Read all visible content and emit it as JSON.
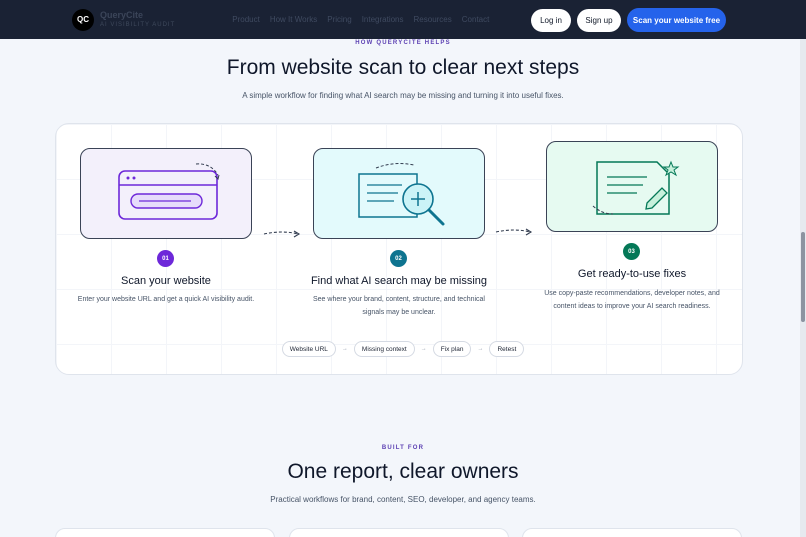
{
  "nav": {
    "logo_initials": "QC",
    "brand_name": "QueryCite",
    "brand_tagline": "AI VISIBILITY AUDIT",
    "links": [
      "Product",
      "How It Works",
      "Pricing",
      "Integrations",
      "Resources",
      "Contact"
    ],
    "login_label": "Log in",
    "signup_label": "Sign up",
    "cta_label": "Scan your website free"
  },
  "how": {
    "eyebrow": "HOW QUERYCITE HELPS",
    "title": "From website scan to clear next steps",
    "subtitle": "A simple workflow for finding what AI search may be missing and turning it into useful fixes.",
    "steps": [
      {
        "num": "01",
        "title": "Scan your website",
        "desc": "Enter your website URL and get a quick AI visibility audit.",
        "color": "#6d28d9",
        "icon": "browser-window-icon"
      },
      {
        "num": "02",
        "title": "Find what AI search may be missing",
        "desc": "See where your brand, content, structure, and technical signals may be unclear.",
        "color": "#0e7490",
        "icon": "magnify-document-icon"
      },
      {
        "num": "03",
        "title": "Get ready-to-use fixes",
        "desc": "Use copy-paste recommendations, developer notes, and content ideas to improve your AI search readiness.",
        "color": "#047857",
        "icon": "edit-document-icon"
      }
    ],
    "chips": [
      "Website URL",
      "Missing context",
      "Fix plan",
      "Retest"
    ],
    "chip_separator": "→"
  },
  "built_for": {
    "eyebrow": "BUILT FOR",
    "title": "One report, clear owners",
    "subtitle": "Practical workflows for brand, content, SEO, developer, and agency teams."
  },
  "colors": {
    "nav_bg": "#1a2234",
    "accent": "#2563eb",
    "eyebrow": "#5b3fb2",
    "step1_tint": "#f3f0fb",
    "step2_tint": "#e3fafc",
    "step3_tint": "#e6faf1"
  }
}
